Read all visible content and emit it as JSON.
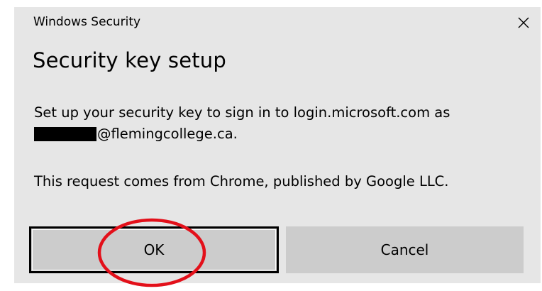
{
  "window": {
    "title": "Windows Security",
    "close_icon": "close-icon"
  },
  "dialog": {
    "heading": "Security key setup",
    "message_line1": "Set up your security key to sign in to login.microsoft.com as",
    "message_line2_suffix": "@flemingcollege.ca.",
    "message_line3": "This request comes from Chrome, published by Google LLC."
  },
  "buttons": {
    "ok_label": "OK",
    "cancel_label": "Cancel"
  },
  "colors": {
    "dialog_background": "#e6e6e6",
    "button_background": "#cccccc",
    "annotation_circle": "#e3101a"
  }
}
